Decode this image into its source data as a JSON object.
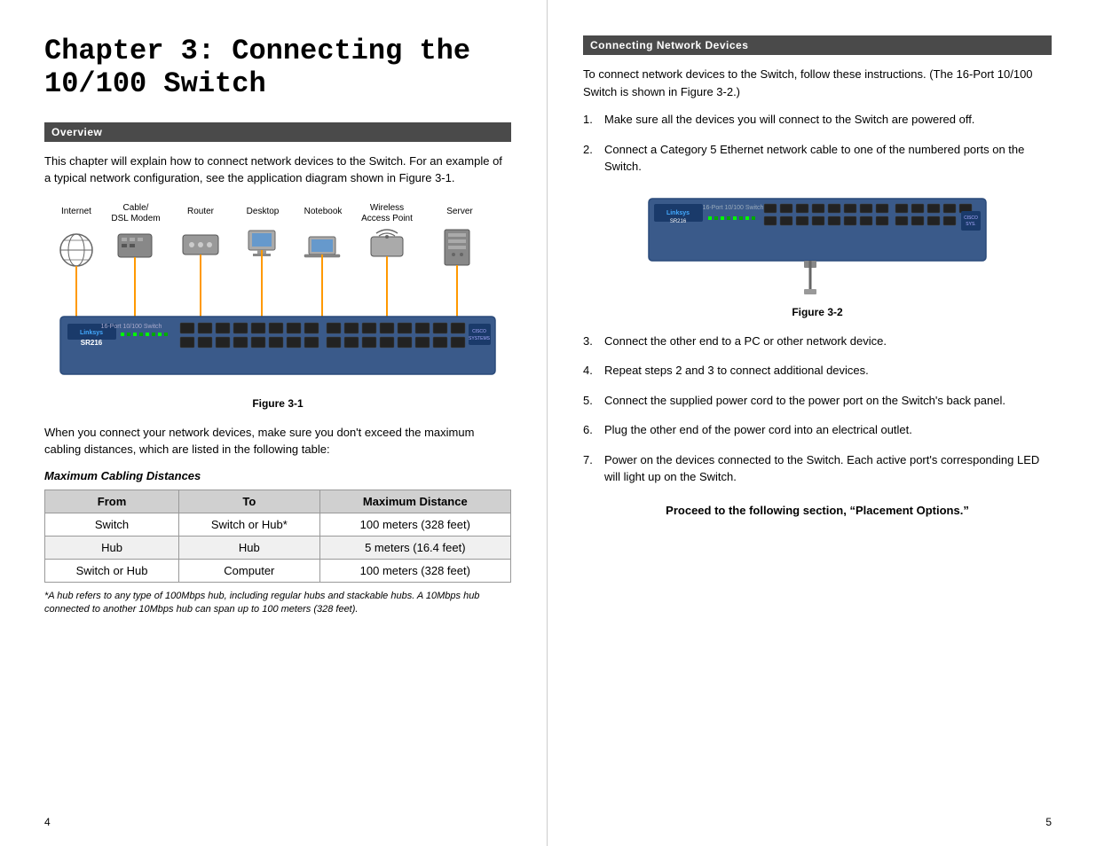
{
  "left": {
    "chapter_title": "Chapter 3: Connecting the 10/100 Switch",
    "overview_header": "Overview",
    "overview_text": "This chapter will explain how to connect network devices to the Switch. For an example of a typical network configuration, see the application diagram shown in Figure 3-1.",
    "figure1_caption": "Figure 3-1",
    "body_text": "When you connect your network devices, make sure you don't exceed the maximum cabling distances, which are listed in the following table:",
    "table_title": "Maximum Cabling Distances",
    "table_headers": [
      "From",
      "To",
      "Maximum Distance"
    ],
    "table_rows": [
      [
        "Switch",
        "Switch or Hub*",
        "100 meters (328 feet)"
      ],
      [
        "Hub",
        "Hub",
        "5 meters (16.4 feet)"
      ],
      [
        "Switch or Hub",
        "Computer",
        "100 meters (328 feet)"
      ]
    ],
    "footnote": "*A hub refers to any type of 100Mbps hub, including regular hubs and stackable hubs. A 10Mbps hub connected to another 10Mbps hub can span up to 100 meters (328 feet).",
    "page_number": "4"
  },
  "right": {
    "connecting_header": "Connecting Network Devices",
    "intro_text": "To connect network devices to the Switch, follow these instructions. (The 16-Port 10/100 Switch is shown in Figure 3-2.)",
    "figure2_caption": "Figure 3-2",
    "instructions": [
      {
        "num": "1.",
        "text": "Make sure all the devices you will connect to the Switch are powered off."
      },
      {
        "num": "2.",
        "text": "Connect a Category 5 Ethernet network cable to one of the numbered ports on the Switch."
      },
      {
        "num": "3.",
        "text": "Connect the other end to a PC or other network device."
      },
      {
        "num": "4.",
        "text": "Repeat steps 2 and 3 to connect additional devices."
      },
      {
        "num": "5.",
        "text": "Connect the supplied power cord to the power port on the Switch's back panel."
      },
      {
        "num": "6.",
        "text": "Plug the other end of the power cord into an electrical outlet."
      },
      {
        "num": "7.",
        "text": "Power on the devices connected to the Switch. Each active port's corresponding LED will light up on the Switch."
      }
    ],
    "proceed_text": "Proceed to the following section, “Placement Options.”",
    "page_number": "5"
  },
  "network_diagram": {
    "labels": [
      "Internet",
      "Cable/\nDSL Modem",
      "Router",
      "Desktop",
      "Notebook",
      "Wireless\nAccess Point",
      "Server"
    ],
    "switch_model": "SR216"
  }
}
